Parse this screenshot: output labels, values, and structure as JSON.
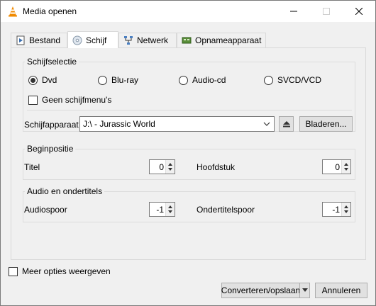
{
  "window": {
    "title": "Media openen"
  },
  "tabs": [
    {
      "label": "Bestand",
      "icon": "file-play-icon"
    },
    {
      "label": "Schijf",
      "icon": "disc-icon"
    },
    {
      "label": "Netwerk",
      "icon": "network-icon"
    },
    {
      "label": "Opnameapparaat",
      "icon": "capture-card-icon"
    }
  ],
  "disc_selection": {
    "legend": "Schijfselectie",
    "options": [
      {
        "label": "Dvd",
        "selected": true
      },
      {
        "label": "Blu-ray",
        "selected": false
      },
      {
        "label": "Audio-cd",
        "selected": false
      },
      {
        "label": "SVCD/VCD",
        "selected": false
      }
    ],
    "no_menus_label": "Geen schijfmenu's",
    "device_label": "Schijfapparaat",
    "device_value": "J:\\ - Jurassic World",
    "browse_label": "Bladeren..."
  },
  "start_position": {
    "legend": "Beginpositie",
    "title_label": "Titel",
    "title_value": "0",
    "chapter_label": "Hoofdstuk",
    "chapter_value": "0"
  },
  "audio_subs": {
    "legend": "Audio en ondertitels",
    "audio_label": "Audiospoor",
    "audio_value": "-1",
    "subs_label": "Ondertitelspoor",
    "subs_value": "-1"
  },
  "footer": {
    "more_options_label": "Meer opties weergeven",
    "convert_label": "Converteren/opslaan",
    "cancel_label": "Annuleren"
  }
}
